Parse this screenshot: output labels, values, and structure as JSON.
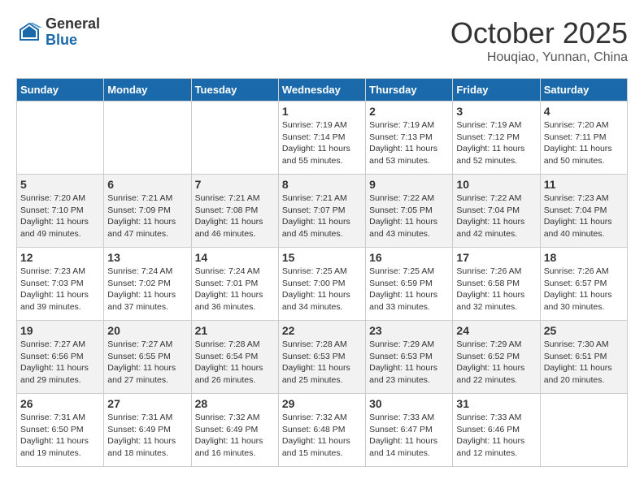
{
  "header": {
    "logo_general": "General",
    "logo_blue": "Blue",
    "month_title": "October 2025",
    "location": "Houqiao, Yunnan, China"
  },
  "days_of_week": [
    "Sunday",
    "Monday",
    "Tuesday",
    "Wednesday",
    "Thursday",
    "Friday",
    "Saturday"
  ],
  "weeks": [
    [
      {
        "day": "",
        "info": ""
      },
      {
        "day": "",
        "info": ""
      },
      {
        "day": "",
        "info": ""
      },
      {
        "day": "1",
        "info": "Sunrise: 7:19 AM\nSunset: 7:14 PM\nDaylight: 11 hours\nand 55 minutes."
      },
      {
        "day": "2",
        "info": "Sunrise: 7:19 AM\nSunset: 7:13 PM\nDaylight: 11 hours\nand 53 minutes."
      },
      {
        "day": "3",
        "info": "Sunrise: 7:19 AM\nSunset: 7:12 PM\nDaylight: 11 hours\nand 52 minutes."
      },
      {
        "day": "4",
        "info": "Sunrise: 7:20 AM\nSunset: 7:11 PM\nDaylight: 11 hours\nand 50 minutes."
      }
    ],
    [
      {
        "day": "5",
        "info": "Sunrise: 7:20 AM\nSunset: 7:10 PM\nDaylight: 11 hours\nand 49 minutes."
      },
      {
        "day": "6",
        "info": "Sunrise: 7:21 AM\nSunset: 7:09 PM\nDaylight: 11 hours\nand 47 minutes."
      },
      {
        "day": "7",
        "info": "Sunrise: 7:21 AM\nSunset: 7:08 PM\nDaylight: 11 hours\nand 46 minutes."
      },
      {
        "day": "8",
        "info": "Sunrise: 7:21 AM\nSunset: 7:07 PM\nDaylight: 11 hours\nand 45 minutes."
      },
      {
        "day": "9",
        "info": "Sunrise: 7:22 AM\nSunset: 7:05 PM\nDaylight: 11 hours\nand 43 minutes."
      },
      {
        "day": "10",
        "info": "Sunrise: 7:22 AM\nSunset: 7:04 PM\nDaylight: 11 hours\nand 42 minutes."
      },
      {
        "day": "11",
        "info": "Sunrise: 7:23 AM\nSunset: 7:04 PM\nDaylight: 11 hours\nand 40 minutes."
      }
    ],
    [
      {
        "day": "12",
        "info": "Sunrise: 7:23 AM\nSunset: 7:03 PM\nDaylight: 11 hours\nand 39 minutes."
      },
      {
        "day": "13",
        "info": "Sunrise: 7:24 AM\nSunset: 7:02 PM\nDaylight: 11 hours\nand 37 minutes."
      },
      {
        "day": "14",
        "info": "Sunrise: 7:24 AM\nSunset: 7:01 PM\nDaylight: 11 hours\nand 36 minutes."
      },
      {
        "day": "15",
        "info": "Sunrise: 7:25 AM\nSunset: 7:00 PM\nDaylight: 11 hours\nand 34 minutes."
      },
      {
        "day": "16",
        "info": "Sunrise: 7:25 AM\nSunset: 6:59 PM\nDaylight: 11 hours\nand 33 minutes."
      },
      {
        "day": "17",
        "info": "Sunrise: 7:26 AM\nSunset: 6:58 PM\nDaylight: 11 hours\nand 32 minutes."
      },
      {
        "day": "18",
        "info": "Sunrise: 7:26 AM\nSunset: 6:57 PM\nDaylight: 11 hours\nand 30 minutes."
      }
    ],
    [
      {
        "day": "19",
        "info": "Sunrise: 7:27 AM\nSunset: 6:56 PM\nDaylight: 11 hours\nand 29 minutes."
      },
      {
        "day": "20",
        "info": "Sunrise: 7:27 AM\nSunset: 6:55 PM\nDaylight: 11 hours\nand 27 minutes."
      },
      {
        "day": "21",
        "info": "Sunrise: 7:28 AM\nSunset: 6:54 PM\nDaylight: 11 hours\nand 26 minutes."
      },
      {
        "day": "22",
        "info": "Sunrise: 7:28 AM\nSunset: 6:53 PM\nDaylight: 11 hours\nand 25 minutes."
      },
      {
        "day": "23",
        "info": "Sunrise: 7:29 AM\nSunset: 6:53 PM\nDaylight: 11 hours\nand 23 minutes."
      },
      {
        "day": "24",
        "info": "Sunrise: 7:29 AM\nSunset: 6:52 PM\nDaylight: 11 hours\nand 22 minutes."
      },
      {
        "day": "25",
        "info": "Sunrise: 7:30 AM\nSunset: 6:51 PM\nDaylight: 11 hours\nand 20 minutes."
      }
    ],
    [
      {
        "day": "26",
        "info": "Sunrise: 7:31 AM\nSunset: 6:50 PM\nDaylight: 11 hours\nand 19 minutes."
      },
      {
        "day": "27",
        "info": "Sunrise: 7:31 AM\nSunset: 6:49 PM\nDaylight: 11 hours\nand 18 minutes."
      },
      {
        "day": "28",
        "info": "Sunrise: 7:32 AM\nSunset: 6:49 PM\nDaylight: 11 hours\nand 16 minutes."
      },
      {
        "day": "29",
        "info": "Sunrise: 7:32 AM\nSunset: 6:48 PM\nDaylight: 11 hours\nand 15 minutes."
      },
      {
        "day": "30",
        "info": "Sunrise: 7:33 AM\nSunset: 6:47 PM\nDaylight: 11 hours\nand 14 minutes."
      },
      {
        "day": "31",
        "info": "Sunrise: 7:33 AM\nSunset: 6:46 PM\nDaylight: 11 hours\nand 12 minutes."
      },
      {
        "day": "",
        "info": ""
      }
    ]
  ]
}
